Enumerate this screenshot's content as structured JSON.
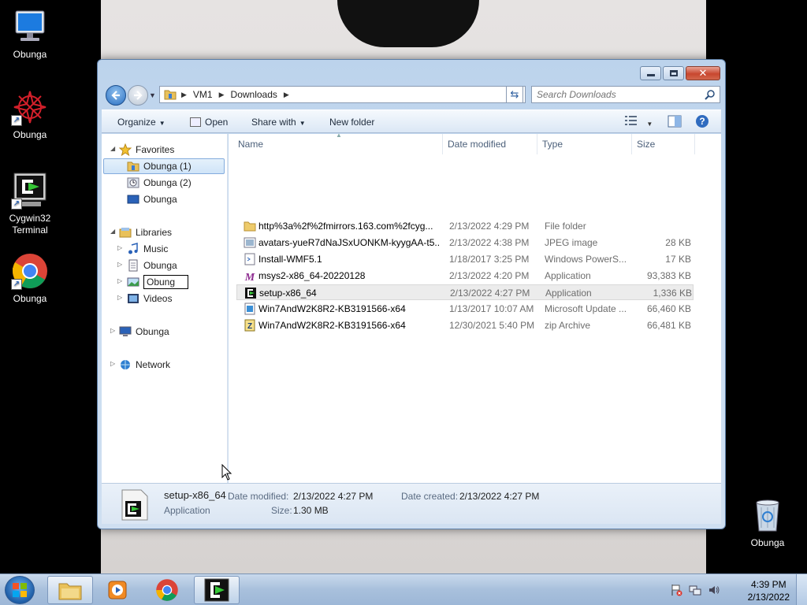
{
  "desktop": {
    "icons": [
      {
        "label": "Obunga",
        "icon": "computer-icon"
      },
      {
        "label": "Obunga",
        "icon": "red-flower-shortcut-icon"
      },
      {
        "label": "Cygwin32\nTerminal",
        "icon": "cygwin-terminal-icon"
      },
      {
        "label": "Obunga",
        "icon": "chrome-shortcut-icon"
      },
      {
        "label": "Obunga",
        "icon": "recycle-bin-icon"
      }
    ]
  },
  "window": {
    "address": {
      "segments": [
        "VM1",
        "Downloads"
      ]
    },
    "search_placeholder": "Search Downloads",
    "toolbar": {
      "organize": "Organize",
      "open": "Open",
      "share_with": "Share with",
      "new_folder": "New folder"
    },
    "nav": {
      "favorites": "Favorites",
      "favorites_items": [
        "Obunga (1)",
        "Obunga (2)",
        "Obunga"
      ],
      "libraries": "Libraries",
      "libraries_items": [
        "Music",
        "Obunga",
        "Obung",
        "Videos"
      ],
      "computer": "Obunga",
      "network": "Network"
    },
    "columns": {
      "name": "Name",
      "date": "Date modified",
      "type": "Type",
      "size": "Size"
    },
    "files": [
      {
        "name": "http%3a%2f%2fmirrors.163.com%2fcyg...",
        "date": "2/13/2022 4:29 PM",
        "type": "File folder",
        "size": "",
        "icon": "folder-icon"
      },
      {
        "name": "avatars-yueR7dNaJSxUONKM-kyygAA-t5...",
        "date": "2/13/2022 4:38 PM",
        "type": "JPEG image",
        "size": "28 KB",
        "icon": "jpeg-image-icon"
      },
      {
        "name": "Install-WMF5.1",
        "date": "1/18/2017 3:25 PM",
        "type": "Windows PowerS...",
        "size": "17 KB",
        "icon": "powershell-script-icon"
      },
      {
        "name": "msys2-x86_64-20220128",
        "date": "2/13/2022 4:20 PM",
        "type": "Application",
        "size": "93,383 KB",
        "icon": "msys2-app-icon"
      },
      {
        "name": "setup-x86_64",
        "date": "2/13/2022 4:27 PM",
        "type": "Application",
        "size": "1,336 KB",
        "icon": "cygwin-setup-icon"
      },
      {
        "name": "Win7AndW2K8R2-KB3191566-x64",
        "date": "1/13/2017 10:07 AM",
        "type": "Microsoft Update ...",
        "size": "66,460 KB",
        "icon": "msu-update-icon"
      },
      {
        "name": "Win7AndW2K8R2-KB3191566-x64",
        "date": "12/30/2021 5:40 PM",
        "type": "zip Archive",
        "size": "66,481 KB",
        "icon": "zip-archive-icon"
      }
    ],
    "details": {
      "name": "setup-x86_64",
      "type": "Application",
      "modified_label": "Date modified:",
      "modified": "2/13/2022 4:27 PM",
      "created_label": "Date created:",
      "created": "2/13/2022 4:27 PM",
      "size_label": "Size:",
      "size": "1.30 MB"
    }
  },
  "taskbar": {
    "clock_time": "4:39 PM",
    "clock_date": "2/13/2022"
  }
}
